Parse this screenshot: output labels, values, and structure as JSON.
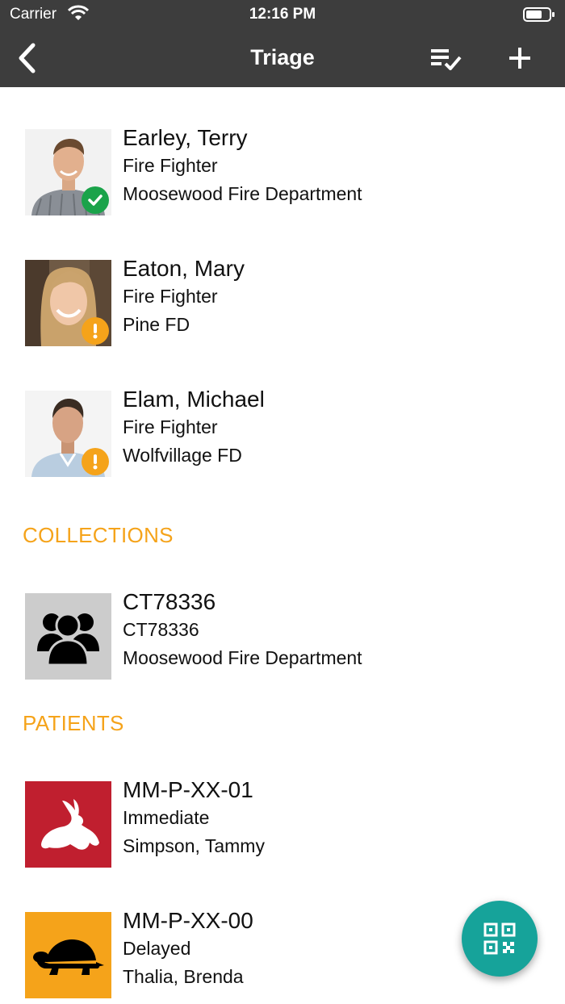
{
  "status_bar": {
    "carrier": "Carrier",
    "time": "12:16 PM"
  },
  "nav": {
    "title": "Triage",
    "back_icon": "chevron-left-icon",
    "sort_icon": "list-check-icon",
    "add_icon": "plus-icon"
  },
  "people": [
    {
      "name": "Earley, Terry",
      "role": "Fire Fighter",
      "org": "Moosewood Fire Department",
      "status": "ok"
    },
    {
      "name": "Eaton, Mary",
      "role": "Fire Fighter",
      "org": "Pine FD",
      "status": "warning"
    },
    {
      "name": "Elam, Michael",
      "role": "Fire Fighter",
      "org": "Wolfvillage FD",
      "status": "warning"
    }
  ],
  "collections": {
    "header": "COLLECTIONS",
    "items": [
      {
        "title": "CT78336",
        "code": "CT78336",
        "org": "Moosewood Fire Department",
        "icon": "group-icon"
      }
    ]
  },
  "patients": {
    "header": "PATIENTS",
    "items": [
      {
        "id": "MM-P-XX-01",
        "priority": "Immediate",
        "name": "Simpson, Tammy",
        "icon": "rabbit-icon",
        "color": "#c01f2f"
      },
      {
        "id": "MM-P-XX-00",
        "priority": "Delayed",
        "name": "Thalia, Brenda",
        "icon": "turtle-icon",
        "color": "#f5a31a"
      }
    ]
  },
  "colors": {
    "header_bg": "#3d3d3d",
    "section_accent": "#f5a31a",
    "ok": "#1aa34a",
    "warning": "#f5a31a",
    "fab": "#16a39a"
  },
  "fab": {
    "icon": "qr-code-icon"
  }
}
